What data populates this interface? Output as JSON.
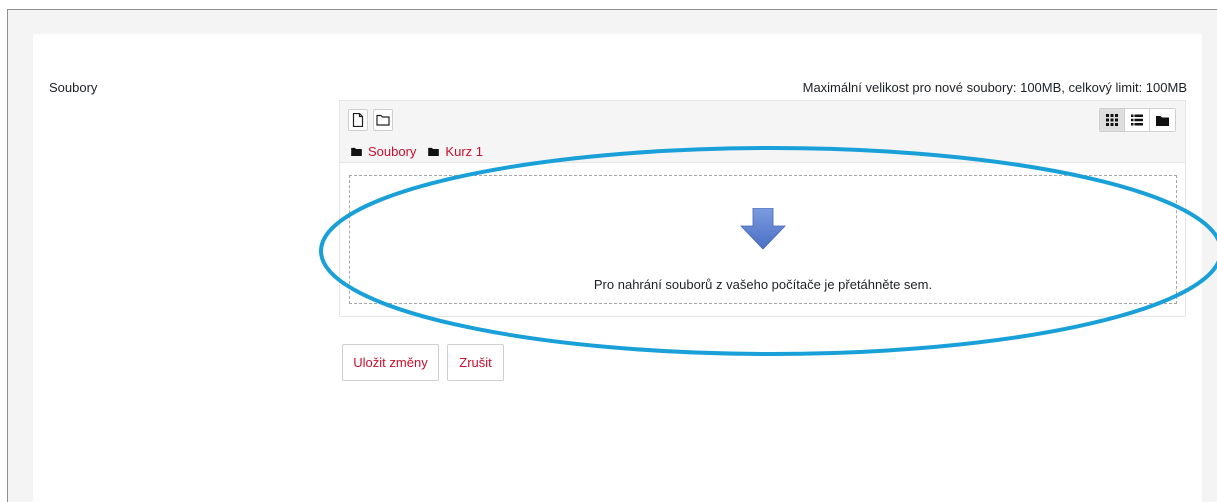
{
  "form": {
    "files_label": "Soubory",
    "limits_text": "Maximální velikost pro nové soubory: 100MB, celkový limit: 100MB"
  },
  "filemanager": {
    "toolbar": {
      "add_file_icon": "file-icon",
      "create_folder_icon": "folder-outline-icon",
      "views": [
        {
          "name": "icons-view",
          "icon": "grid-icon",
          "active": true
        },
        {
          "name": "list-view",
          "icon": "list-icon",
          "active": false
        },
        {
          "name": "tree-view",
          "icon": "folder-icon",
          "active": false
        }
      ]
    },
    "breadcrumb": [
      "Soubory",
      "Kurz 1"
    ],
    "dropzone_text": "Pro nahrání souborů z vašeho počítače je přetáhněte sem.",
    "dropzone_icon": "down-arrow-icon"
  },
  "actions": {
    "save_label": "Uložit změny",
    "cancel_label": "Zrušit"
  },
  "colors": {
    "link_accent": "#c8102e",
    "annotation_ellipse": "#1aa0d8",
    "arrow": "#5b7fd0"
  }
}
